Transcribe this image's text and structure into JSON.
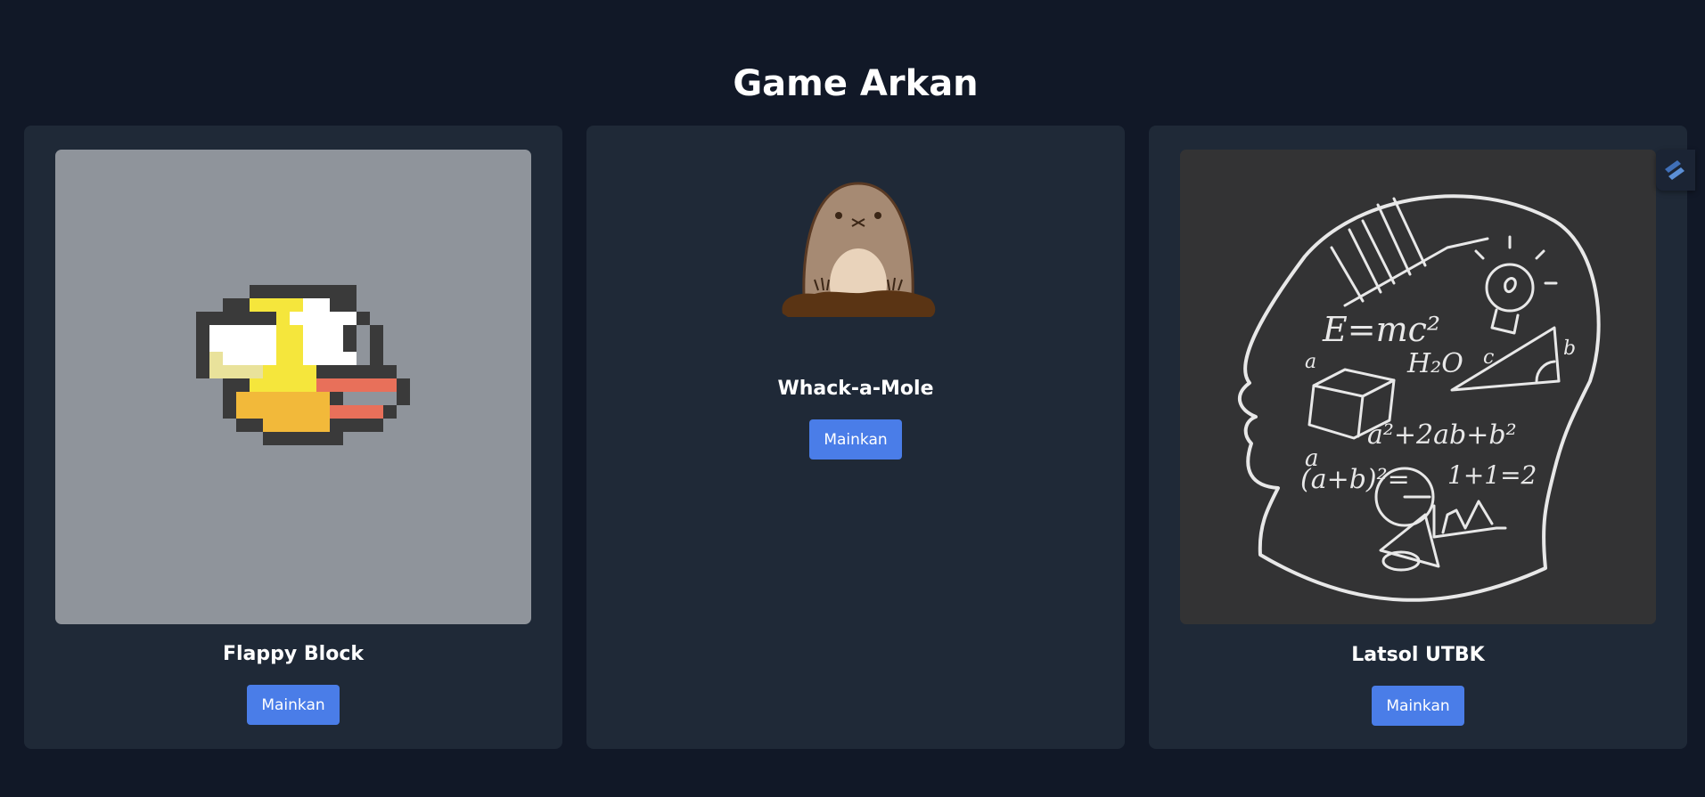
{
  "page": {
    "title": "Game Arkan"
  },
  "games": [
    {
      "title": "Flappy Block",
      "button_label": "Mainkan",
      "icon": "flappy-bird-image"
    },
    {
      "title": "Whack-a-Mole",
      "button_label": "Mainkan",
      "icon": "mole-image"
    },
    {
      "title": "Latsol UTBK",
      "button_label": "Mainkan",
      "icon": "chalkboard-head-image"
    }
  ],
  "colors": {
    "background": "#111827",
    "card": "#1f2937",
    "button": "#4a7de8",
    "text": "#ffffff"
  },
  "widget": {
    "icon": "lightning-badge-icon"
  }
}
